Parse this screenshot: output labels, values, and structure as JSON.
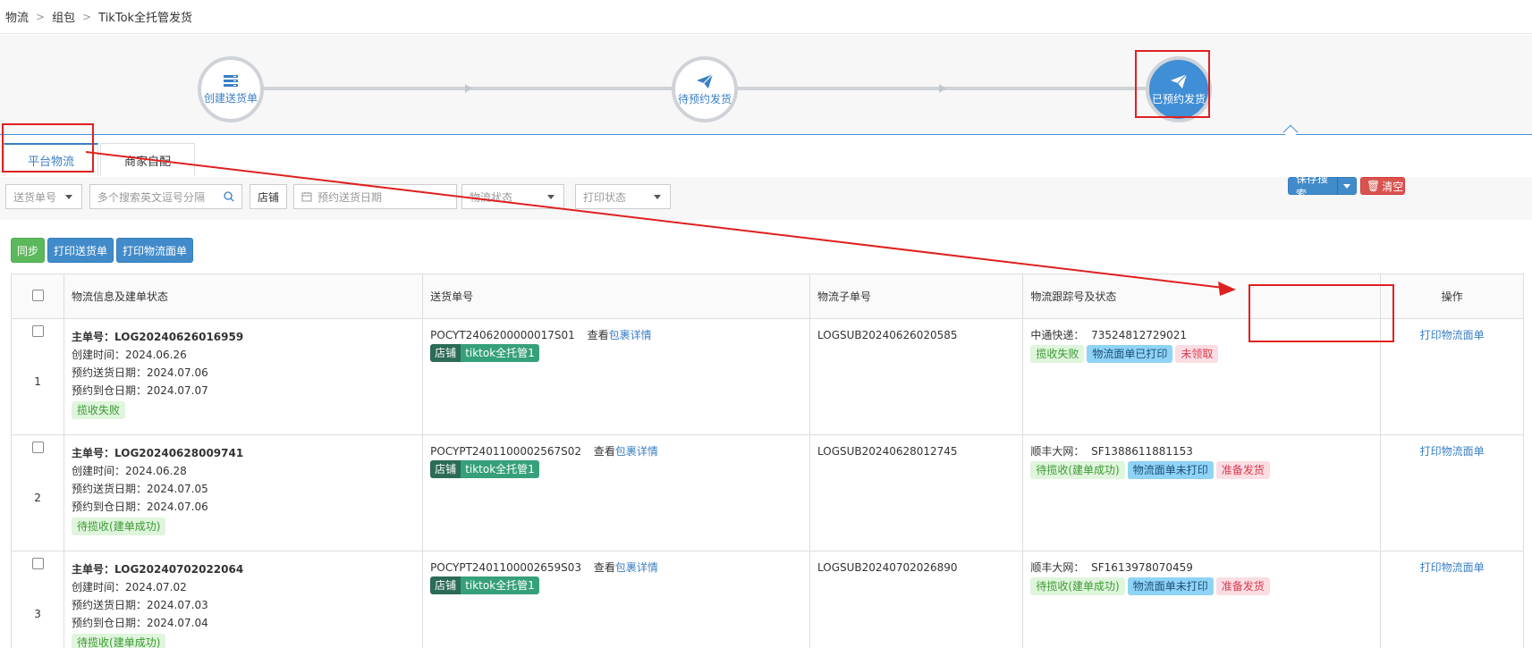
{
  "breadcrumb": [
    "物流",
    "组包",
    "TikTok全托管发货"
  ],
  "steps": [
    {
      "label": "创建送货单",
      "icon": "stack-icon",
      "active": false
    },
    {
      "label": "待预约发货",
      "icon": "paper-plane-icon",
      "active": false
    },
    {
      "label": "已预约发货",
      "icon": "paper-plane-icon",
      "active": true
    }
  ],
  "tabs": [
    {
      "label": "平台物流",
      "active": true
    },
    {
      "label": "商家自配",
      "active": false
    }
  ],
  "filters": {
    "delivery_no_select": "送货单号",
    "search_placeholder": "多个搜索英文逗号分隔",
    "shop_label": "店铺",
    "date_placeholder": "预约送货日期",
    "logistics_status": "物流状态",
    "print_status": "打印状态",
    "save_search": "保存搜索",
    "clear": "清空"
  },
  "actions": {
    "sync": "同步",
    "print_delivery": "打印送货单",
    "print_logistics": "打印物流面单"
  },
  "table": {
    "headers": [
      "物流信息及建单状态",
      "送货单号",
      "物流子单号",
      "物流跟踪号及状态",
      "操作"
    ],
    "rows": [
      {
        "num": "1",
        "main_label": "主单号：",
        "main_no": "LOG20240626016959",
        "created": "创建时间：2024.06.26",
        "send_date": "预约送货日期：2024.07.06",
        "arrive_date": "预约到仓日期：2024.07.07",
        "status": "揽收失败",
        "delivery_no": "POCYT2406200000017S01",
        "view": "查看",
        "detail": "包裹详情",
        "shop_key": "店铺",
        "shop_val": "tiktok全托管1",
        "sub_no": "LOGSUB20240626020585",
        "carrier": "中通快递：",
        "tracking": "73524812729021",
        "tags": [
          "揽收失败",
          "物流面单已打印",
          "未领取"
        ],
        "op": "打印物流面单"
      },
      {
        "num": "2",
        "main_label": "主单号：",
        "main_no": "LOG20240628009741",
        "created": "创建时间：2024.06.28",
        "send_date": "预约送货日期：2024.07.05",
        "arrive_date": "预约到仓日期：2024.07.06",
        "status": "待揽收(建单成功)",
        "delivery_no": "POCYPT2401100002567S02",
        "view": "查看",
        "detail": "包裹详情",
        "shop_key": "店铺",
        "shop_val": "tiktok全托管1",
        "sub_no": "LOGSUB20240628012745",
        "carrier": "顺丰大网：",
        "tracking": "SF1388611881153",
        "tags": [
          "待揽收(建单成功)",
          "物流面单未打印",
          "准备发货"
        ],
        "op": "打印物流面单"
      },
      {
        "num": "3",
        "main_label": "主单号：",
        "main_no": "LOG20240702022064",
        "created": "创建时间：2024.07.02",
        "send_date": "预约送货日期：2024.07.03",
        "arrive_date": "预约到仓日期：2024.07.04",
        "status": "待揽收(建单成功)",
        "delivery_no": "POCYPT2401100002659S03",
        "view": "查看",
        "detail": "包裹详情",
        "shop_key": "店铺",
        "shop_val": "tiktok全托管1",
        "sub_no": "LOGSUB20240702026890",
        "carrier": "顺丰大网：",
        "tracking": "SF1613978070459",
        "tags": [
          "待揽收(建单成功)",
          "物流面单未打印",
          "准备发货"
        ],
        "op": "打印物流面单"
      }
    ]
  },
  "colors": {
    "accent": "#3f8ed6",
    "annotation": "#e02020"
  }
}
